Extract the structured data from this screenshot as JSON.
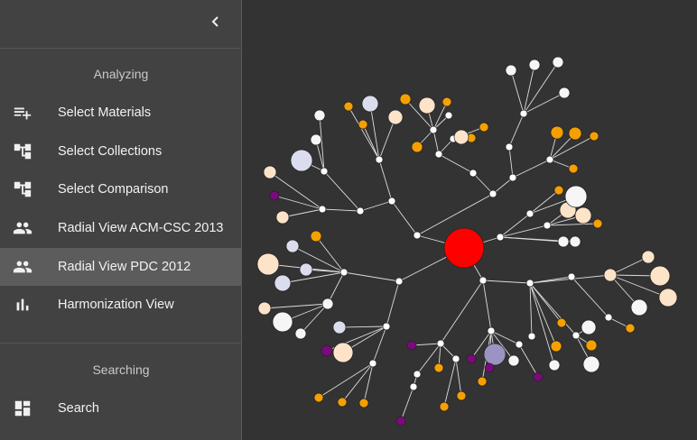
{
  "sidebar": {
    "collapse_icon": "chevron-left-icon",
    "sections": [
      {
        "title": "Analyzing",
        "items": [
          {
            "label": "Select Materials",
            "icon": "playlist-add-icon",
            "active": false
          },
          {
            "label": "Select Collections",
            "icon": "account-tree-icon",
            "active": false
          },
          {
            "label": "Select Comparison",
            "icon": "account-tree-icon",
            "active": false
          },
          {
            "label": "Radial View ACM-CSC 2013",
            "icon": "people-icon",
            "active": false
          },
          {
            "label": "Radial View PDC 2012",
            "icon": "people-icon",
            "active": true
          },
          {
            "label": "Harmonization View",
            "icon": "bar-chart-icon",
            "active": false
          }
        ]
      },
      {
        "title": "Searching",
        "items": [
          {
            "label": "Search",
            "icon": "dashboard-icon",
            "active": false
          }
        ]
      }
    ]
  },
  "graph": {
    "colors": {
      "background": "#333333",
      "link": "#dddddd",
      "root": "#ff0000",
      "junction": "#ffffff",
      "orange": "#f5a000",
      "purple": "#7b0a7b",
      "peach": "#fde3c8",
      "lavender": "#dcdcef",
      "white": "#f6f6f6",
      "slate": "#9c93c2"
    }
  }
}
